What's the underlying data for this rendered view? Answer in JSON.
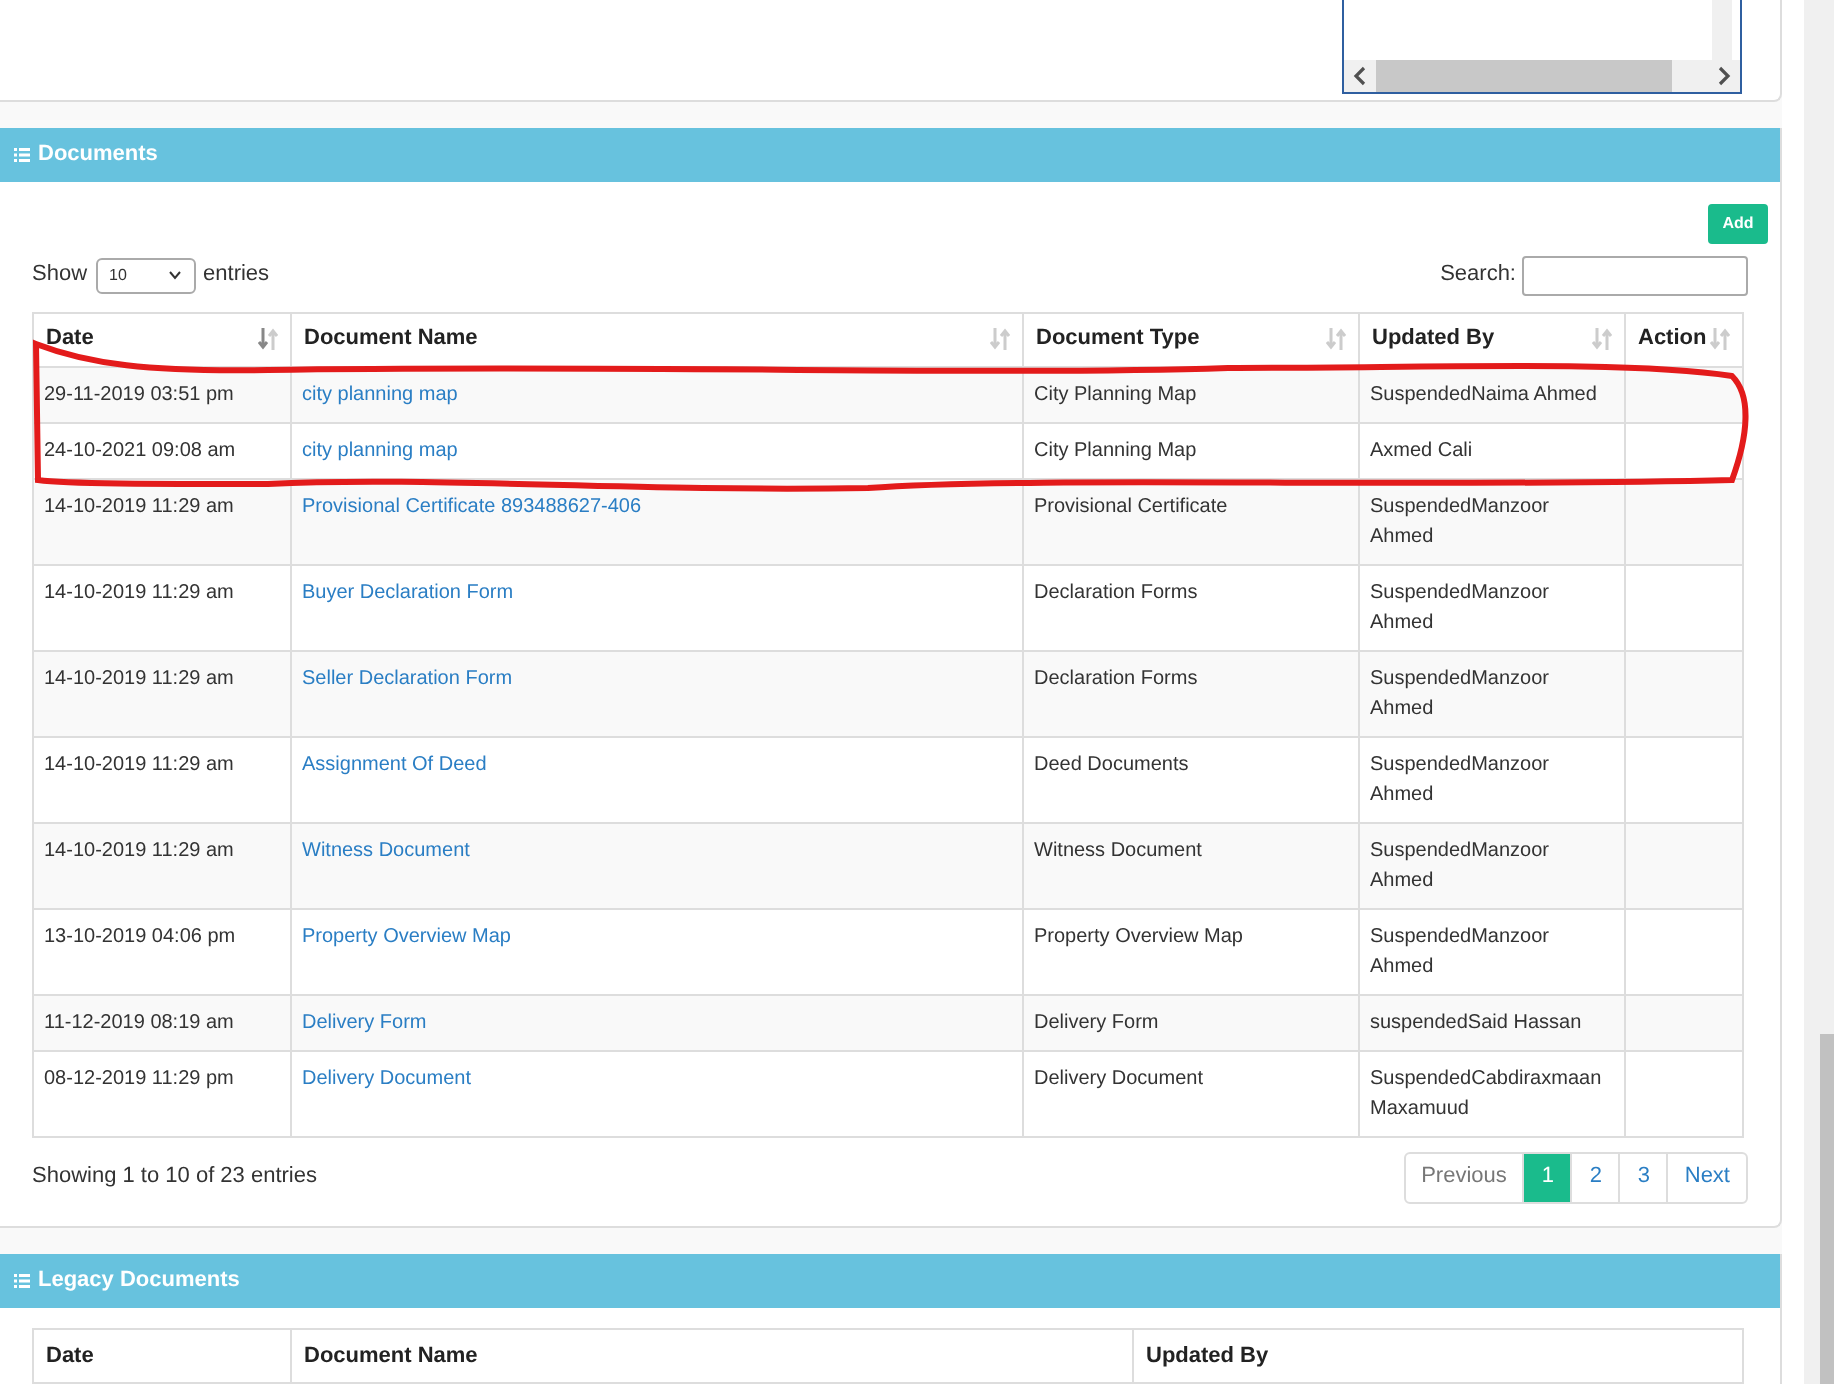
{
  "documents": {
    "title": "Documents",
    "add_button": "Add",
    "length": {
      "before": "Show",
      "value": "10",
      "after": "entries"
    },
    "search": {
      "label": "Search:"
    },
    "columns": [
      {
        "label": "Date",
        "sorted": true
      },
      {
        "label": "Document Name",
        "sorted": false
      },
      {
        "label": "Document Type",
        "sorted": false
      },
      {
        "label": "Updated By",
        "sorted": false
      },
      {
        "label": "Action",
        "sorted": false
      }
    ],
    "rows": [
      {
        "date": "29-11-2019 03:51 pm",
        "document_name": "city planning map",
        "document_type": "City Planning Map",
        "updated_by": "SuspendedNaima Ahmed"
      },
      {
        "date": "24-10-2021 09:08 am",
        "document_name": "city planning map",
        "document_type": "City Planning Map",
        "updated_by": "Axmed Cali"
      },
      {
        "date": "14-10-2019 11:29 am",
        "document_name": "Provisional Certificate 893488627-406",
        "document_type": "Provisional Certificate",
        "updated_by": "SuspendedManzoor Ahmed"
      },
      {
        "date": "14-10-2019 11:29 am",
        "document_name": "Buyer Declaration Form",
        "document_type": "Declaration Forms",
        "updated_by": "SuspendedManzoor Ahmed"
      },
      {
        "date": "14-10-2019 11:29 am",
        "document_name": "Seller Declaration Form",
        "document_type": "Declaration Forms",
        "updated_by": "SuspendedManzoor Ahmed"
      },
      {
        "date": "14-10-2019 11:29 am",
        "document_name": "Assignment Of Deed",
        "document_type": "Deed Documents",
        "updated_by": "SuspendedManzoor Ahmed"
      },
      {
        "date": "14-10-2019 11:29 am",
        "document_name": "Witness Document",
        "document_type": "Witness Document",
        "updated_by": "SuspendedManzoor Ahmed"
      },
      {
        "date": "13-10-2019 04:06 pm",
        "document_name": "Property Overview Map",
        "document_type": "Property Overview Map",
        "updated_by": "SuspendedManzoor Ahmed"
      },
      {
        "date": "11-12-2019 08:19 am",
        "document_name": "Delivery Form",
        "document_type": "Delivery Form",
        "updated_by": "suspendedSaid Hassan"
      },
      {
        "date": "08-12-2019 11:29 pm",
        "document_name": "Delivery Document",
        "document_type": "Delivery Document",
        "updated_by": "SuspendedCabdiraxmaan Maxamuud"
      }
    ],
    "info": "Showing 1 to 10 of 23 entries",
    "pagination": [
      {
        "label": "Previous",
        "kind": "nav",
        "selected": false,
        "disabled": true
      },
      {
        "label": "1",
        "kind": "page",
        "selected": true,
        "disabled": false
      },
      {
        "label": "2",
        "kind": "page",
        "selected": false,
        "disabled": false
      },
      {
        "label": "3",
        "kind": "page",
        "selected": false,
        "disabled": false
      },
      {
        "label": "Next",
        "kind": "nav",
        "selected": false,
        "disabled": false
      }
    ]
  },
  "legacy_documents": {
    "title": "Legacy Documents",
    "columns": [
      "Date",
      "Document Name",
      "Updated By"
    ]
  }
}
